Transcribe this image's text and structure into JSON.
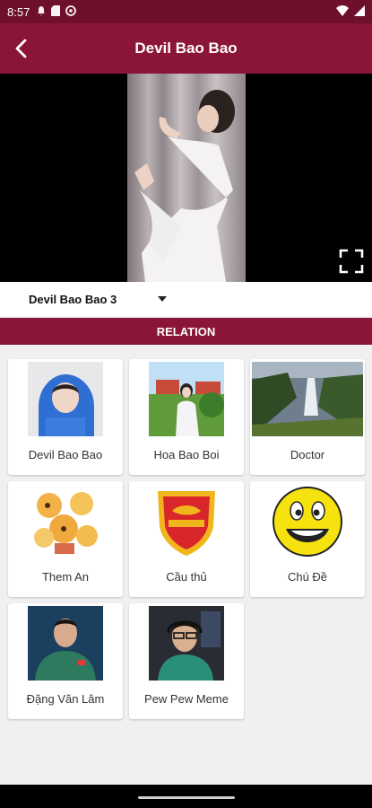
{
  "status": {
    "time": "8:57"
  },
  "header": {
    "title": "Devil Bao Bao"
  },
  "player": {
    "selected_video": "Devil Bao Bao 3"
  },
  "relation": {
    "title": "RELATION",
    "items": [
      {
        "label": "Devil Bao Bao"
      },
      {
        "label": "Hoa Bao Boi"
      },
      {
        "label": "Doctor"
      },
      {
        "label": "Them An"
      },
      {
        "label": "Cầu thủ"
      },
      {
        "label": "Chú Đề"
      },
      {
        "label": "Đặng Văn Lâm"
      },
      {
        "label": "Pew Pew Meme"
      }
    ]
  },
  "colors": {
    "primary": "#8b1538",
    "status_bar": "#6e0f2c"
  }
}
